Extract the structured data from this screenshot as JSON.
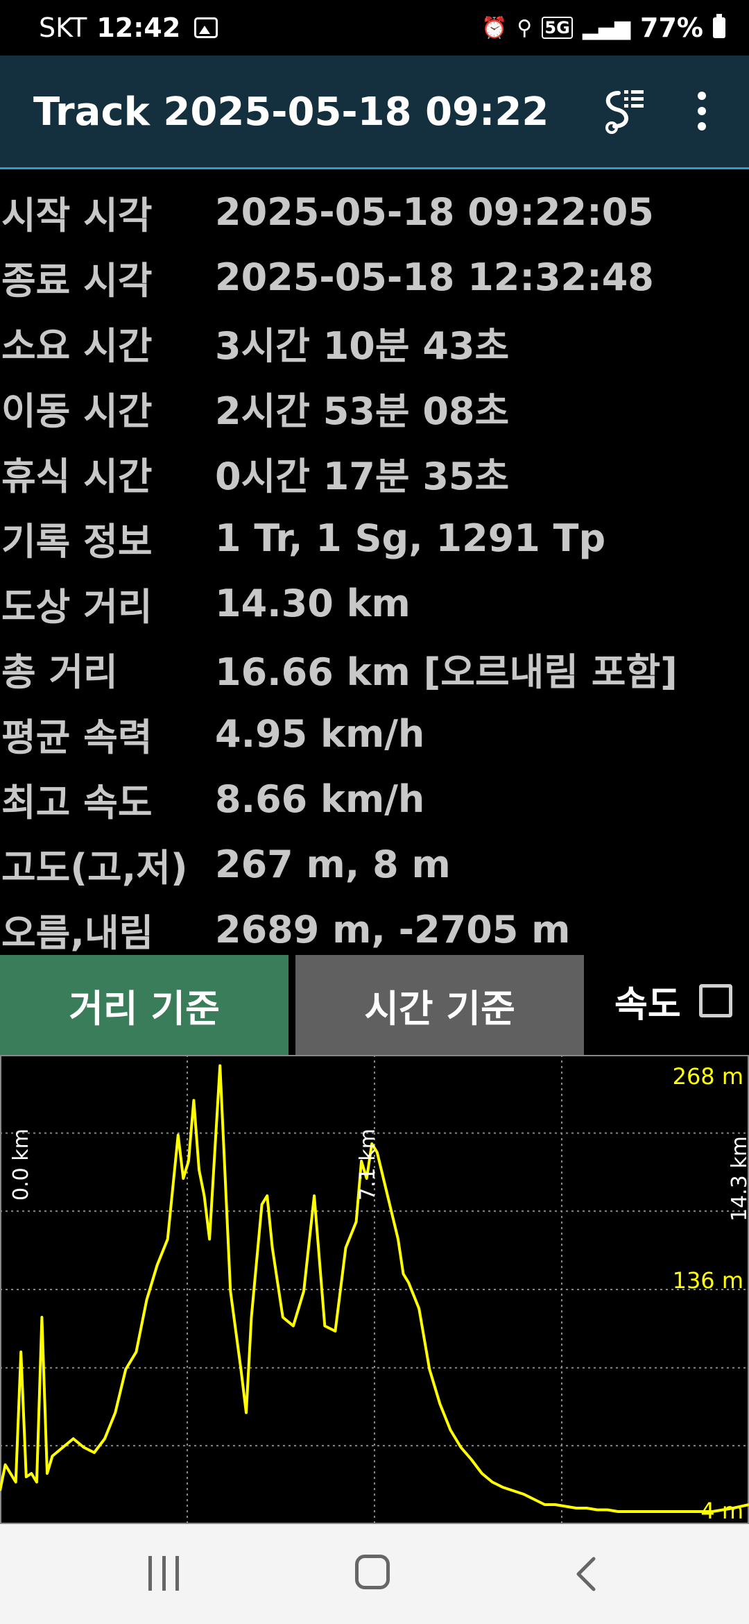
{
  "status_bar": {
    "carrier": "SKT",
    "time": "12:42",
    "network": "5G",
    "battery": "77%"
  },
  "app_bar": {
    "title": "Track 2025-05-18 09:22"
  },
  "stats": [
    {
      "label": "시작 시각",
      "value": "2025-05-18 09:22:05"
    },
    {
      "label": "종료 시각",
      "value": "2025-05-18 12:32:48"
    },
    {
      "label": "소요 시간",
      "value": "3시간 10분 43초"
    },
    {
      "label": "이동 시간",
      "value": "2시간 53분 08초"
    },
    {
      "label": "휴식 시간",
      "value": "0시간 17분 35초"
    },
    {
      "label": "기록 정보",
      "value": "1 Tr, 1 Sg, 1291 Tp"
    },
    {
      "label": "도상 거리",
      "value": "14.30 km"
    },
    {
      "label": "총 거리",
      "value": "16.66 km [오르내림 포함]"
    },
    {
      "label": "평균 속력",
      "value": "4.95 km/h"
    },
    {
      "label": "최고 속도",
      "value": "8.66 km/h"
    },
    {
      "label": "고도(고,저)",
      "value": "267 m, 8 m"
    },
    {
      "label": "오름,내림",
      "value": "2689 m, -2705 m"
    }
  ],
  "buttons": {
    "distance": "거리 기준",
    "time": "시간 기준",
    "speed": "속도"
  },
  "chart_data": {
    "type": "line",
    "x_axis": {
      "unit": "km",
      "range": [
        0,
        14.3
      ],
      "labels": [
        "0.0 km",
        "7.1 km",
        "14.3 km"
      ]
    },
    "y_axis": {
      "unit": "m",
      "range": [
        4,
        268
      ],
      "labels": [
        "268 m",
        "136 m",
        "4 m"
      ]
    },
    "grid": true,
    "line_color": "#ffff00",
    "series": [
      {
        "x": [
          0,
          0.1,
          0.2,
          0.3,
          0.4,
          0.5,
          0.6,
          0.7,
          0.8,
          0.9,
          1.0,
          1.2,
          1.4,
          1.6,
          1.8,
          2.0,
          2.2,
          2.4,
          2.6,
          2.8,
          3.0,
          3.2,
          3.4,
          3.5,
          3.6,
          3.7,
          3.8,
          3.9,
          4.0,
          4.2,
          4.4,
          4.6,
          4.7,
          4.8,
          5.0,
          5.1,
          5.2,
          5.4,
          5.6,
          5.8,
          6.0,
          6.2,
          6.4,
          6.6,
          6.8,
          6.9,
          7.0,
          7.1,
          7.2,
          7.4,
          7.6,
          7.7,
          7.8,
          8.0,
          8.2,
          8.4,
          8.6,
          8.8,
          9.0,
          9.2,
          9.4,
          9.6,
          9.8,
          10.0,
          10.2,
          10.4,
          10.6,
          10.8,
          11.0,
          11.2,
          11.4,
          11.6,
          11.8,
          12.0,
          12.2,
          12.4,
          12.6,
          12.8,
          13.0,
          13.2,
          13.4,
          13.6,
          13.8,
          14.0,
          14.3
        ],
        "y": [
          20,
          35,
          30,
          25,
          100,
          28,
          30,
          25,
          120,
          30,
          40,
          45,
          50,
          45,
          42,
          50,
          65,
          90,
          100,
          130,
          150,
          165,
          225,
          200,
          210,
          245,
          205,
          190,
          165,
          265,
          135,
          90,
          65,
          120,
          185,
          190,
          160,
          120,
          115,
          135,
          190,
          115,
          112,
          160,
          175,
          210,
          200,
          220,
          215,
          190,
          165,
          145,
          140,
          125,
          90,
          70,
          55,
          45,
          38,
          30,
          25,
          22,
          20,
          18,
          15,
          12,
          12,
          11,
          10,
          10,
          9,
          9,
          8,
          8,
          8,
          8,
          8,
          8,
          8,
          8,
          8,
          8,
          9,
          10,
          12
        ]
      }
    ]
  }
}
